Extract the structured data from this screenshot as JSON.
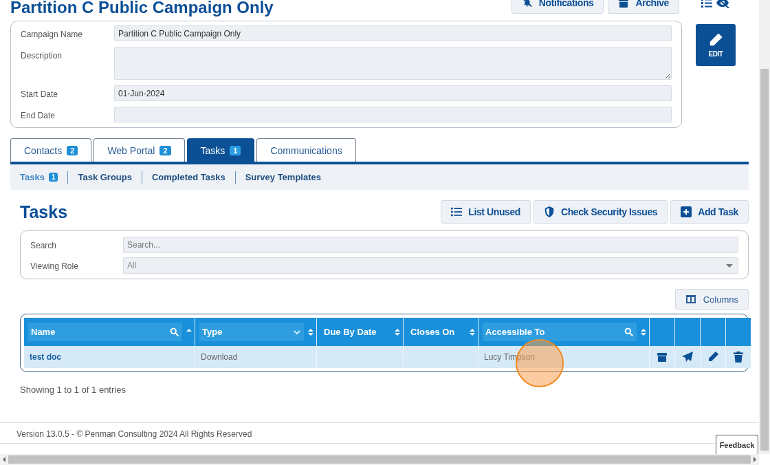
{
  "page_title": "Partition C Public Campaign Only",
  "header_buttons": [
    {
      "label": "Notifications"
    },
    {
      "label": "Archive"
    }
  ],
  "campaign_fields": [
    {
      "label": "Campaign Name",
      "value": "Partition C Public Campaign Only",
      "kind": "text"
    },
    {
      "label": "Description",
      "kind": "textarea"
    },
    {
      "label": "Start Date",
      "value": "01-Jun-2024",
      "kind": "text"
    },
    {
      "label": "End Date",
      "kind": "text"
    }
  ],
  "edit_button": {
    "label": "EDIT"
  },
  "tabs": [
    {
      "label": "Contacts",
      "count": "2",
      "selected": false
    },
    {
      "label": "Web Portal",
      "count": "2",
      "selected": false
    },
    {
      "label": "Tasks",
      "count": "1",
      "selected": true
    },
    {
      "label": "Communications",
      "selected": false
    }
  ],
  "subtabs": [
    {
      "label": "Tasks",
      "count": "1",
      "selected": true
    },
    {
      "label": "Task Groups",
      "selected": false
    },
    {
      "label": "Completed Tasks",
      "selected": false
    },
    {
      "label": "Survey Templates",
      "selected": false
    }
  ],
  "section_title": "Tasks",
  "actions": [
    {
      "label": "List Unused"
    },
    {
      "label": "Check Security Issues"
    },
    {
      "label": "Add Task"
    }
  ],
  "filters": [
    {
      "label": "Search",
      "placeholder": "Search...",
      "kind": "search"
    },
    {
      "label": "Viewing Role",
      "value": "All",
      "kind": "select"
    }
  ],
  "columns_button": {
    "label": "Columns"
  },
  "table": {
    "columns": [
      "Name",
      "Type",
      "Due By Date",
      "Closes On",
      "Accessible To"
    ],
    "rows": [
      {
        "cells": [
          "test doc",
          "Download",
          "",
          "",
          "Lucy Timpson"
        ]
      }
    ]
  },
  "table_info": "Showing 1 to 1 of 1 entries",
  "footer": "Version 13.0.5 - © Penman Consulting 2024 All Rights Reserved",
  "feedback": "Feedback",
  "click_marker": true
}
